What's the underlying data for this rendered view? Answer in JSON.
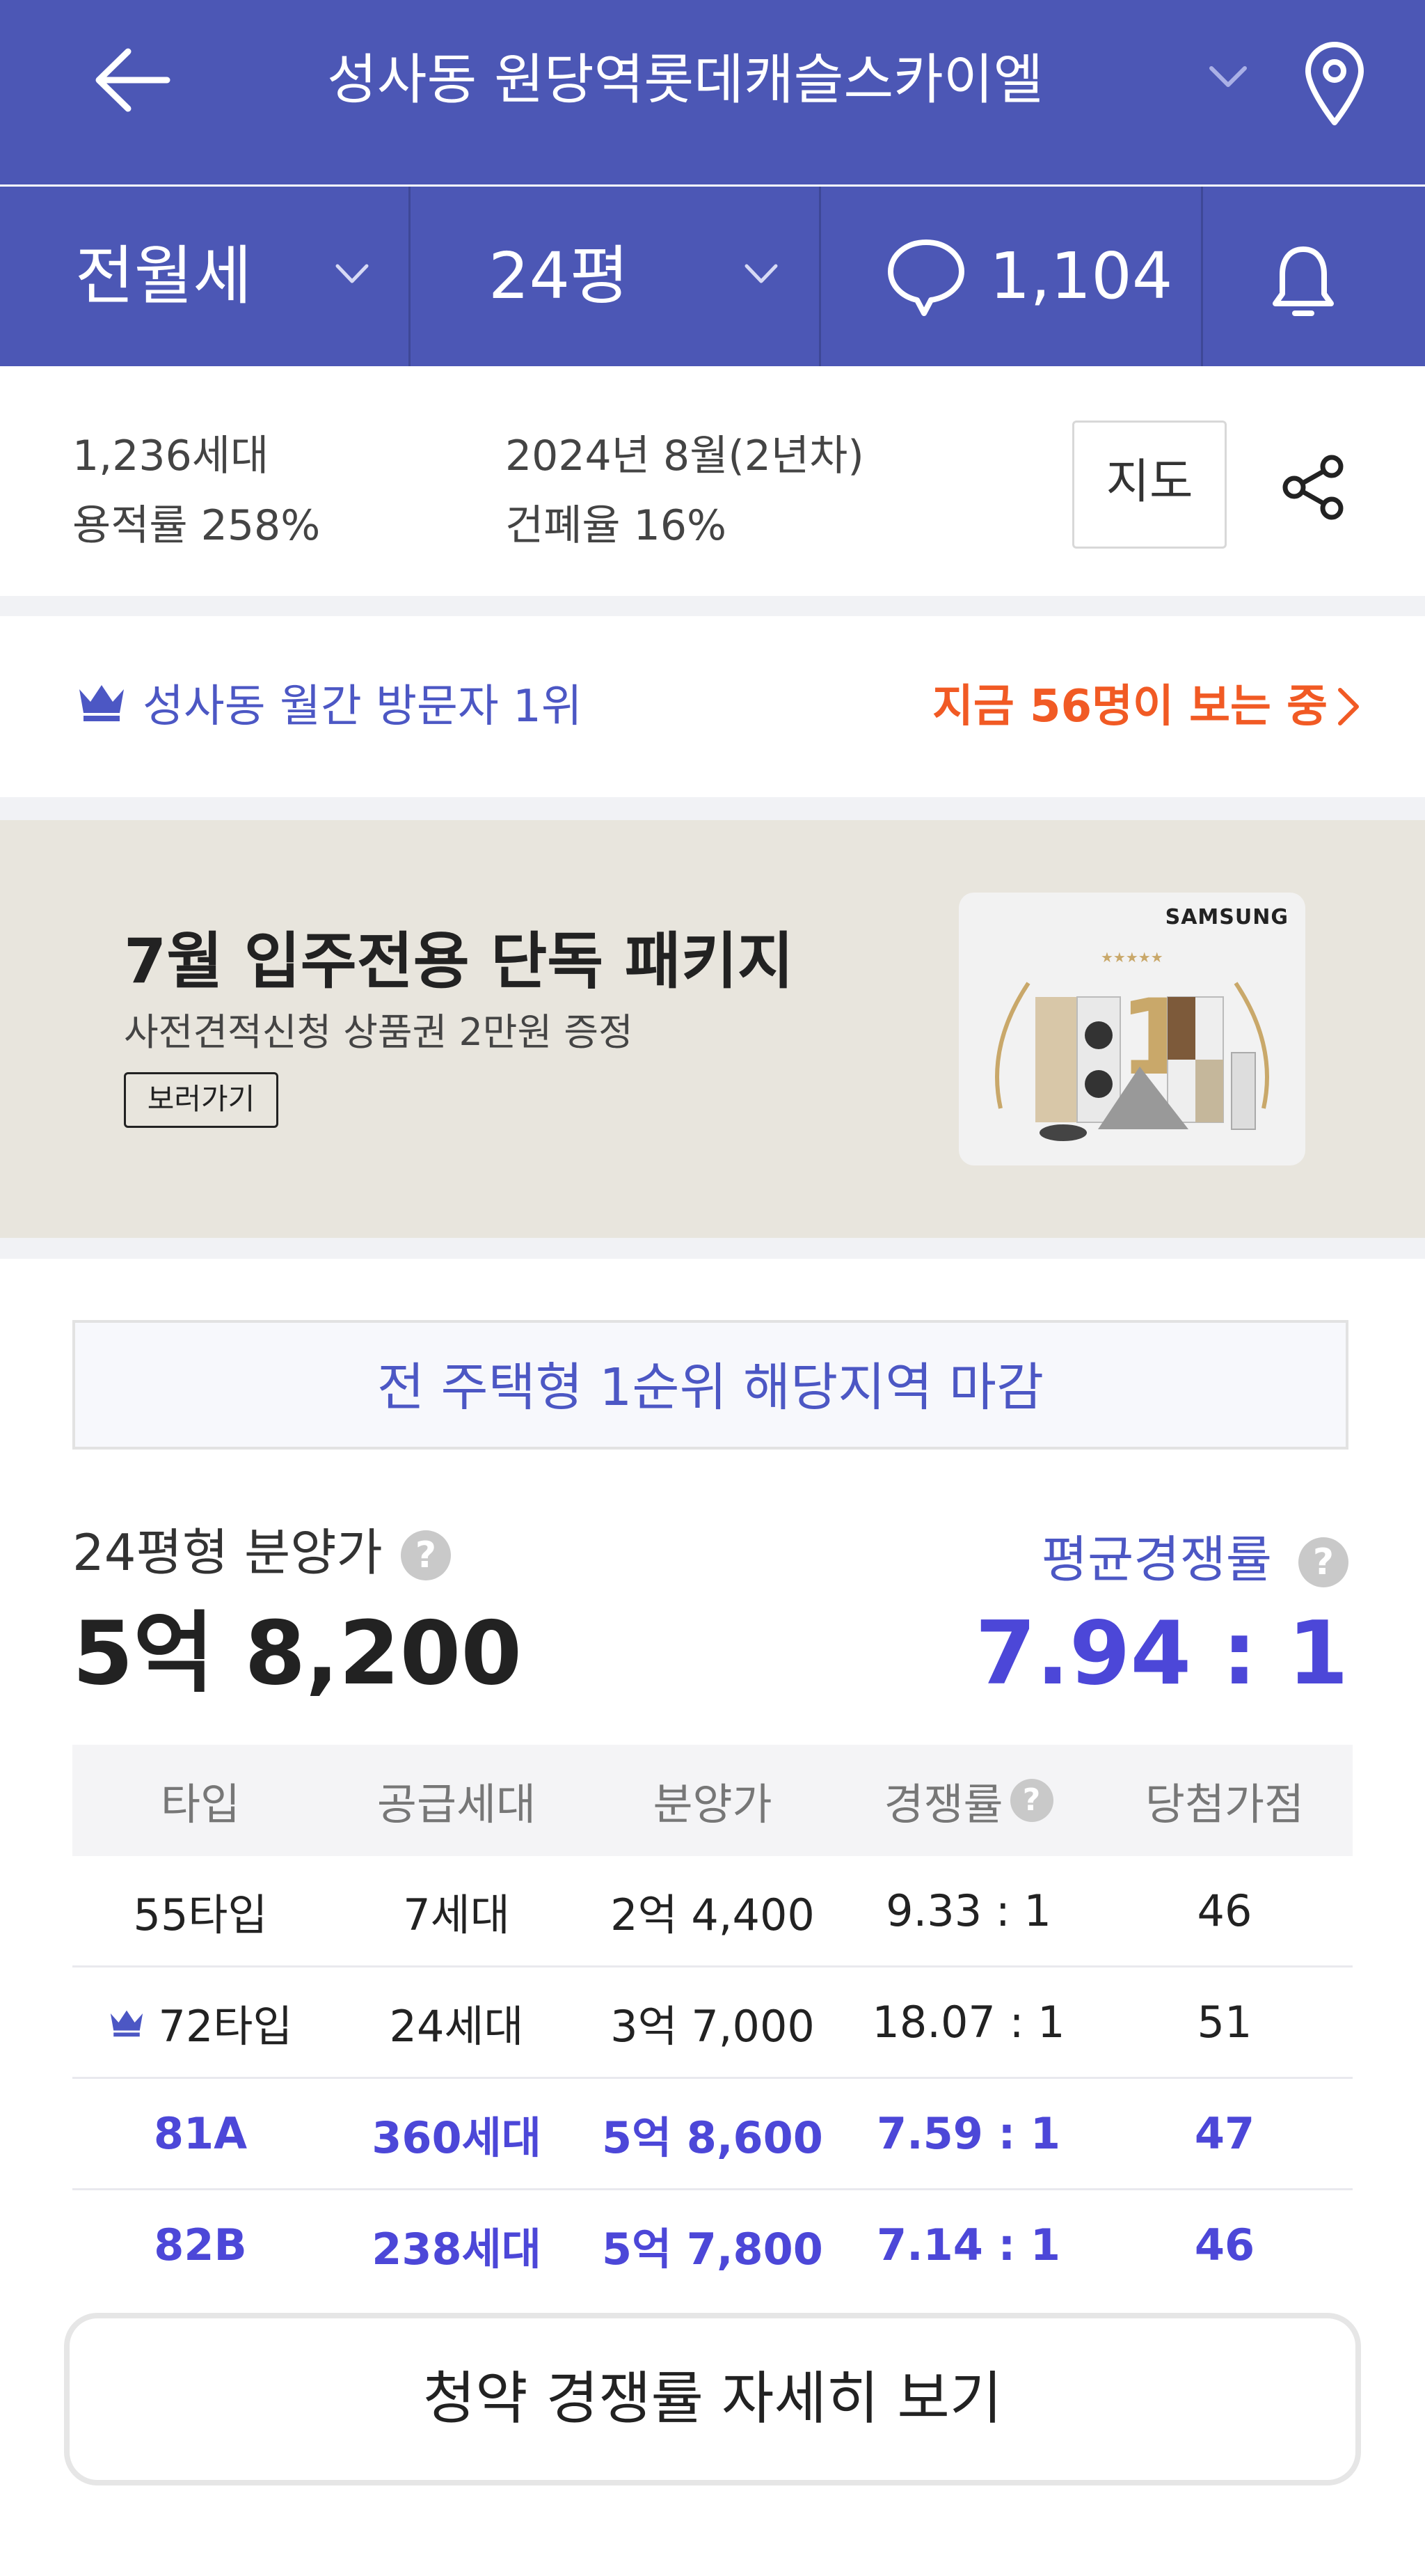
{
  "header": {
    "title": "성사동 원당역롯데캐슬스카이엘"
  },
  "filters": {
    "deal_type": "전월세",
    "size": "24평",
    "comment_count": "1,104"
  },
  "info": {
    "households": "1,236세대",
    "floor_area_ratio": "용적률 258%",
    "move_in": "2024년 8월(2년차)",
    "building_coverage": "건폐율 16%",
    "map_label": "지도"
  },
  "rank": {
    "text": "성사동 월간 방문자 1위",
    "viewers": "지금 56명이 보는 중"
  },
  "banner": {
    "title": "7월 입주전용 단독 패키지",
    "subtitle": "사전견적신청 상품권 2만원 증정",
    "button": "보러가기",
    "brand": "SAMSUNG"
  },
  "notice": "전 주택형 1순위 해당지역 마감",
  "price": {
    "label": "24평형 분양가",
    "value": "5억 8,200",
    "comp_label": "평균경쟁률",
    "comp_value": "7.94 : 1"
  },
  "table": {
    "headers": [
      "타입",
      "공급세대",
      "분양가",
      "경쟁률",
      "당첨가점"
    ],
    "rows": [
      [
        "55타입",
        "7세대",
        "2억 4,400",
        "9.33 : 1",
        "46"
      ],
      [
        "72타입",
        "24세대",
        "3억 7,000",
        "18.07 : 1",
        "51"
      ],
      [
        "81A",
        "360세대",
        "5억 8,600",
        "7.59 : 1",
        "47"
      ],
      [
        "82B",
        "238세대",
        "5억 7,800",
        "7.14 : 1",
        "46"
      ]
    ]
  },
  "detail_button": "청약 경쟁률 자세히 보기",
  "colors": {
    "brand": "#4c57b5",
    "accent": "#4c47d8",
    "hot": "#f15a24"
  }
}
